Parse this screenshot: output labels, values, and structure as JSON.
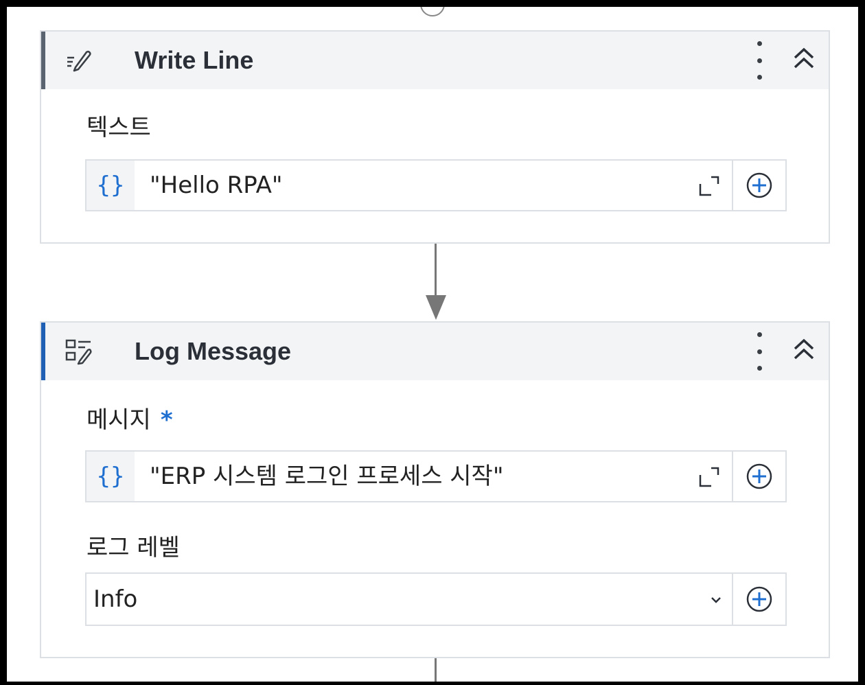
{
  "write_line": {
    "title": "Write Line",
    "icon": "write-line-icon",
    "text_field": {
      "label": "텍스트",
      "value": "\"Hello RPA\""
    }
  },
  "log_message": {
    "title": "Log Message",
    "icon": "log-message-icon",
    "message_field": {
      "label": "메시지",
      "required_mark": "*",
      "value": "\"ERP 시스템 로그인 프로세스 시작\""
    },
    "level_field": {
      "label": "로그 레벨",
      "value": "Info"
    }
  },
  "expression_marker": "{}",
  "colors": {
    "accent": "#1f6fd1",
    "log_accent": "#1f5fb4",
    "header_bg": "#f3f4f5",
    "border": "#dcdfe3"
  }
}
